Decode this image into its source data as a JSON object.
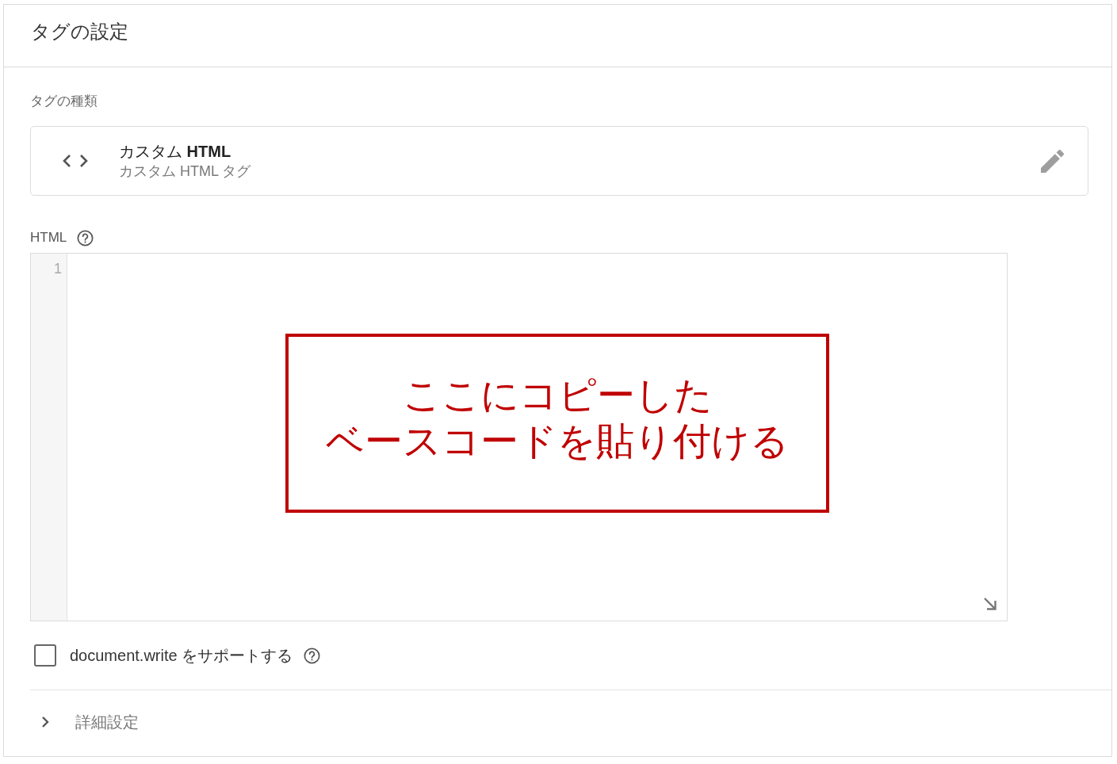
{
  "panel": {
    "title": "タグの設定"
  },
  "tag_type": {
    "label": "タグの種類",
    "name": "カスタム **HTML**",
    "subtitle": "カスタム HTML タグ"
  },
  "html_field": {
    "label": "HTML",
    "line_numbers": [
      "1"
    ]
  },
  "annotation": {
    "lines": [
      "ここにコピーした",
      "ベースコードを貼り付ける"
    ]
  },
  "options": [
    {
      "kind": "checkbox",
      "label": "document.write をサポートする",
      "checked": false
    }
  ],
  "advanced": {
    "label": "詳細設定",
    "expanded": false
  }
}
